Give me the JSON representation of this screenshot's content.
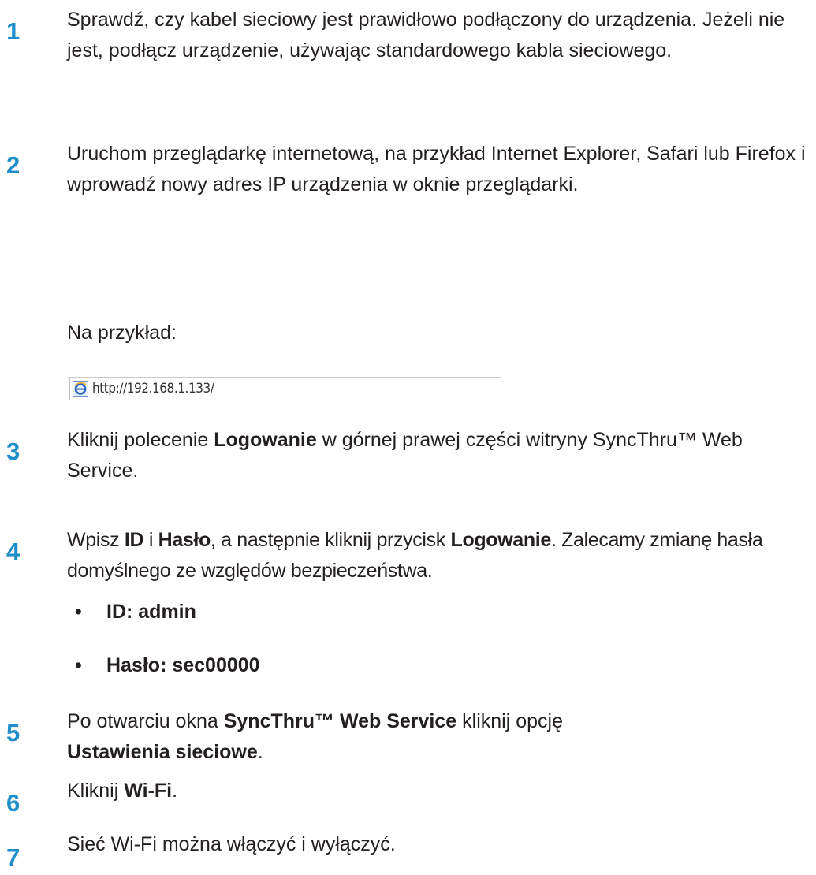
{
  "steps": [
    {
      "number": "1",
      "text": "Sprawdź, czy kabel sieciowy jest prawidłowo podłączony do urządzenia. Jeżeli nie jest, podłącz urządzenie, używając standardowego kabla sieciowego."
    },
    {
      "number": "2",
      "text": "Uruchom przeglądarkę internetową, na przykład Internet Explorer, Safari lub Firefox i wprowadź nowy adres IP urządzenia w oknie przeglądarki.",
      "example_label": "Na przykład:"
    },
    {
      "number": "3",
      "pre": "Kliknij polecenie ",
      "bold1": "Logowanie",
      "post": " w górnej prawej części witryny SyncThru™ Web Service."
    },
    {
      "number": "4",
      "p1": "Wpisz ",
      "b1": "ID",
      "p2": " i ",
      "b2": "Hasło",
      "p3": ", a następnie kliknij przycisk ",
      "b3": "Logowanie",
      "p4": ". Zalecamy zmianę hasła domyślnego ze względów bezpieczeństwa."
    },
    {
      "number": "5",
      "p1": "Po otwarciu okna ",
      "b1": "SyncThru™ Web Service",
      "p2": " kliknij opcję ",
      "b2": "Ustawienia sieciowe",
      "p3": "."
    },
    {
      "number": "6",
      "p1": "Kliknij ",
      "b1": "Wi-Fi",
      "p2": "."
    },
    {
      "number": "7",
      "text": "Sieć Wi-Fi można włączyć i wyłączyć."
    }
  ],
  "bullets": [
    "ID: admin",
    "Hasło: sec00000"
  ],
  "bullet_symbol": "•",
  "address_bar": {
    "url": "http://192.168.1.133/",
    "icon": "ie-browser-icon"
  },
  "colors": {
    "step_number": "#1f8ec9",
    "text": "#231f20"
  }
}
